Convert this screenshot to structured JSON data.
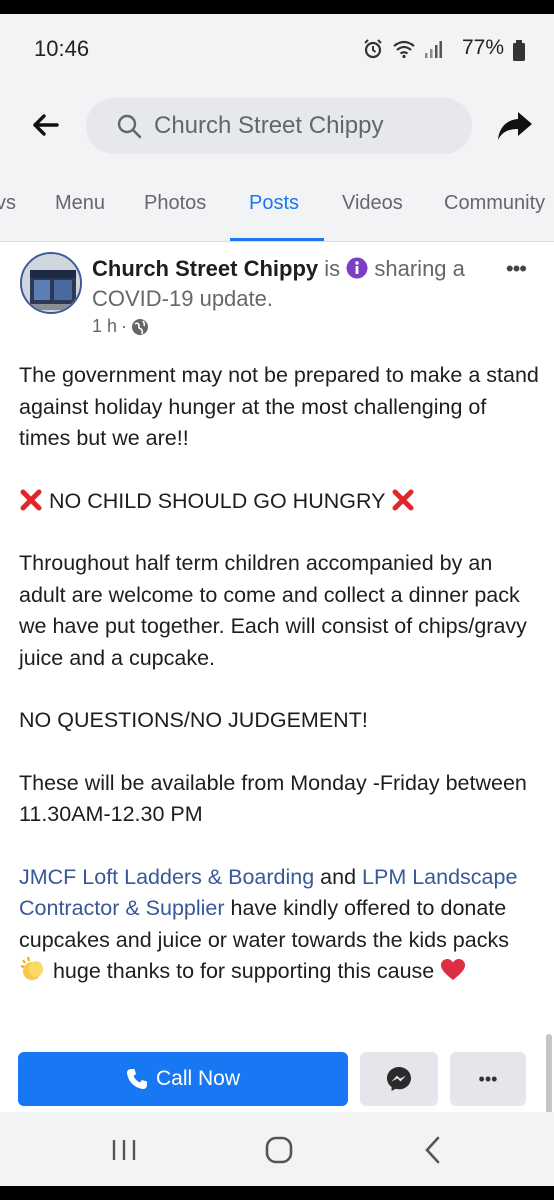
{
  "status_bar": {
    "time": "10:46",
    "battery": "77%"
  },
  "search": {
    "placeholder": "Church Street Chippy"
  },
  "tabs": [
    {
      "label": "vs"
    },
    {
      "label": "Menu"
    },
    {
      "label": "Photos"
    },
    {
      "label": "Posts"
    },
    {
      "label": "Videos"
    },
    {
      "label": "Community"
    }
  ],
  "post": {
    "page_name": "Church Street Chippy",
    "verb": " is ",
    "activity": " sharing a COVID-19 update.",
    "time": "1 h",
    "dot": "·",
    "paragraph1": "The government may not be prepared to make a stand against holiday hunger at the most challenging of times but we are!!",
    "headline": "NO CHILD SHOULD GO HUNGRY",
    "paragraph2": "Throughout half term children accompanied by an adult are welcome to come and collect a dinner pack we have put together. Each will consist of chips/gravy juice and a cupcake.",
    "paragraph3": "NO QUESTIONS/NO JUDGEMENT!",
    "paragraph4": "These will be available from Monday -Friday between 11.30AM-12.30 PM",
    "mention1": "JMCF Loft Ladders & Boarding",
    "and_text": " and ",
    "mention2": "LPM Landscape Contractor & Supplier",
    "paragraph5a": " have kindly offered to donate cupcakes and juice or water towards the kids packs ",
    "paragraph5b": " huge thanks to for supporting this cause "
  },
  "actions": {
    "call_label": "Call Now",
    "more_label": "•••"
  },
  "colors": {
    "accent": "#1877f2",
    "link": "#385898",
    "x_red": "#e0262b",
    "heart": "#dd2e44"
  }
}
